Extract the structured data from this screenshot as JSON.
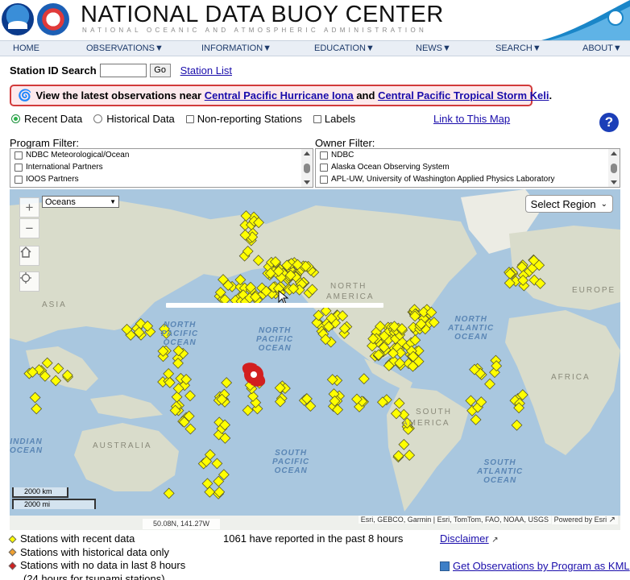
{
  "header": {
    "title": "NATIONAL DATA BUOY CENTER",
    "subtitle": "NATIONAL OCEANIC AND ATMOSPHERIC ADMINISTRATION"
  },
  "nav": {
    "items": [
      "HOME",
      "OBSERVATIONS▼",
      "INFORMATION▼",
      "EDUCATION▼",
      "NEWS▼",
      "SEARCH▼",
      "ABOUT▼"
    ]
  },
  "search": {
    "label": "Station ID Search",
    "value": "",
    "go_label": "Go",
    "station_list": "Station List"
  },
  "alert": {
    "prefix": "View the latest observations near",
    "link1": "Central Pacific Hurricane Iona",
    "conj": "and",
    "link2": "Central Pacific Tropical Storm Keli",
    "suffix": "."
  },
  "options": {
    "recent": "Recent Data",
    "historical": "Historical Data",
    "nonreporting": "Non-reporting Stations",
    "labels": "Labels",
    "link_map": "Link to This Map",
    "help": "?"
  },
  "program_filter": {
    "label": "Program Filter:",
    "items": [
      "NDBC Meteorological/Ocean",
      "International Partners",
      "IOOS Partners"
    ]
  },
  "owner_filter": {
    "label": "Owner Filter:",
    "items": [
      "NDBC",
      "Alaska Ocean Observing System",
      "APL-UW, University of Washington Applied Physics Laboratory"
    ]
  },
  "map": {
    "basemap_select": "Oceans",
    "select_region": "Select Region",
    "zoom_in": "+",
    "zoom_out": "−",
    "scale_km": "2000 km",
    "scale_mi": "2000 mi",
    "coords": "50.08N, 141.27W",
    "attribution": "Esri, GEBCO, Garmin | Esri, TomTom, FAO, NOAA, USGS",
    "powered": "Powered by Esri",
    "labels": {
      "asia": "ASIA",
      "north_america_1": "NORTH",
      "north_america_2": "AMERICA",
      "europe": "EUROPE",
      "africa": "AFRICA",
      "south_america_1": "SOUTH",
      "south_america_2": "AMERICA",
      "australia": "AUSTRALIA",
      "north_pacific_w": [
        "NORTH",
        "PACIFIC",
        "OCEAN"
      ],
      "north_pacific_e": [
        "NORTH",
        "PACIFIC",
        "OCEAN"
      ],
      "north_atlantic": [
        "NORTH",
        "ATLANTIC",
        "OCEAN"
      ],
      "south_pacific": [
        "SOUTH",
        "PACIFIC",
        "OCEAN"
      ],
      "south_atlantic": [
        "SOUTH",
        "ATLANTIC",
        "OCEAN"
      ],
      "indian_ocean": [
        "INDIAN",
        "OCEAN"
      ]
    },
    "colors": {
      "ocean": "#a9c7df",
      "land": "#d9dccb",
      "station_recent": "#ffff00",
      "station_historical": "#f0a030",
      "station_nodata": "#d02020",
      "hurricane": "#d21f1f"
    }
  },
  "legend": {
    "recent": "Stations with recent data",
    "historical": "Stations with historical data only",
    "nodata": "Stations with no data in last 8 hours",
    "nodata_note": "(24 hours for tsunami stations)"
  },
  "footer": {
    "reported": "1061 have reported in the past 8 hours",
    "disclaimer": "Disclaimer",
    "kml": "Get Observations by Program as KML"
  }
}
